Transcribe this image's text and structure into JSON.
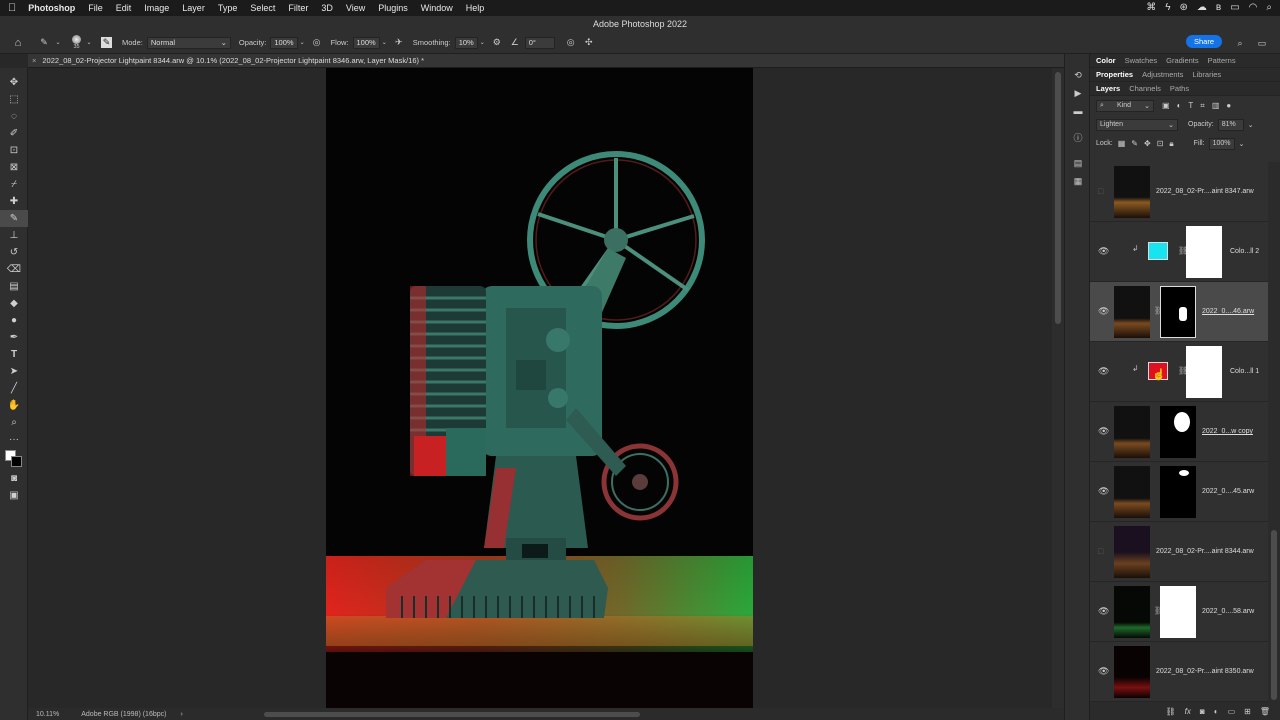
{
  "menubar": {
    "app": "Photoshop",
    "items": [
      "File",
      "Edit",
      "Image",
      "Layer",
      "Type",
      "Select",
      "Filter",
      "3D",
      "View",
      "Plugins",
      "Window",
      "Help"
    ],
    "window_title": "Adobe Photoshop 2022"
  },
  "options": {
    "brush_size": "35",
    "mode_label": "Mode:",
    "mode_value": "Normal",
    "opacity_label": "Opacity:",
    "opacity_value": "100%",
    "flow_label": "Flow:",
    "flow_value": "100%",
    "smoothing_label": "Smoothing:",
    "smoothing_value": "10%",
    "angle_value": "0°",
    "share_label": "Share"
  },
  "document": {
    "tab_title": "2022_08_02-Projector Lightpaint 8344.arw @ 10.1% (2022_08_02-Projector Lightpaint 8346.arw, Layer Mask/16) *",
    "zoom": "10.11%",
    "profile": "Adobe RGB (1998) (16bpc)"
  },
  "panel": {
    "tabs_row1": [
      "Color",
      "Swatches",
      "Gradients",
      "Patterns"
    ],
    "tabs_row2": [
      "Properties",
      "Adjustments",
      "Libraries"
    ],
    "tabs_row3": [
      "Layers",
      "Channels",
      "Paths"
    ],
    "kind_label": "Kind",
    "blend_mode": "Lighten",
    "opacity_label": "Opacity:",
    "opacity_value": "81%",
    "lock_label": "Lock:",
    "fill_label": "Fill:",
    "fill_value": "100%"
  },
  "layers": [
    {
      "name": "2022_08_02-Pr....aint 8347.arw",
      "visible": false
    },
    {
      "name": "Colo...ll 2",
      "swatch": "#18e4f0",
      "visible": true
    },
    {
      "name": "2022_0....46.arw",
      "visible": true,
      "selected": true
    },
    {
      "name": "Colo...ll 1",
      "swatch": "#e01020",
      "visible": true
    },
    {
      "name": "2022_0...w copy",
      "visible": true
    },
    {
      "name": "2022_0....45.arw",
      "visible": true
    },
    {
      "name": "2022_08_02-Pr....aint 8344.arw",
      "visible": false
    },
    {
      "name": "2022_0....58.arw",
      "visible": true
    },
    {
      "name": "2022_08_02-Pr....aint 8350.arw",
      "visible": true
    }
  ]
}
